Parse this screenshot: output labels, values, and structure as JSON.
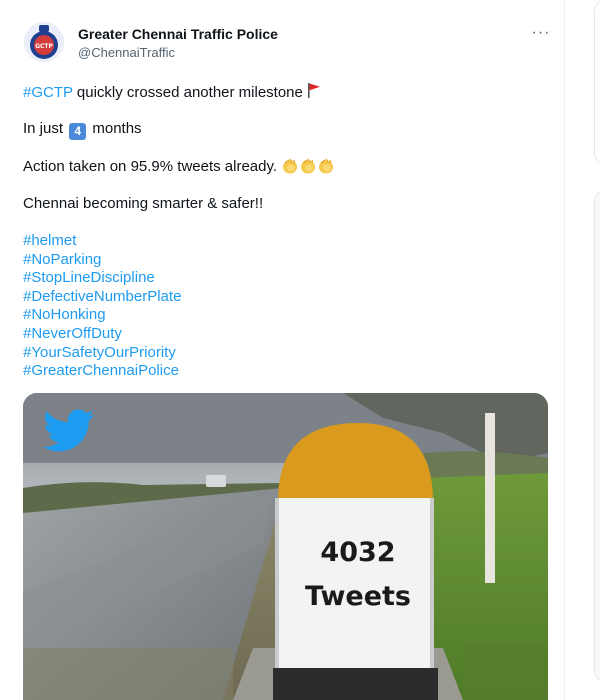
{
  "account": {
    "name": "Greater Chennai Traffic Police",
    "handle": "@ChennaiTraffic",
    "avatar_text": "GCTP"
  },
  "more_label": "···",
  "tweet": {
    "line1_tag": "#GCTP",
    "line1_text": " quickly crossed another milestone ",
    "line2_pre": "In just ",
    "line2_num": "4",
    "line2_post": " months",
    "line3_text": "Action taken on 95.9% tweets already.",
    "line4_text": "Chennai becoming smarter & safer!!",
    "hashtags": [
      "#helmet",
      "#NoParking",
      "#StopLineDiscipline",
      "#DefectiveNumberPlate",
      "#NoHonking",
      "#NeverOffDuty",
      "#YourSafetyOurPriority",
      "#GreaterChennaiPolice"
    ]
  },
  "media": {
    "milestone_count": "4032",
    "milestone_label": "Tweets"
  },
  "colors": {
    "link": "#1d9bf0",
    "milestone_top": "#d99a1e",
    "twitter_blue": "#1d9bf0"
  }
}
